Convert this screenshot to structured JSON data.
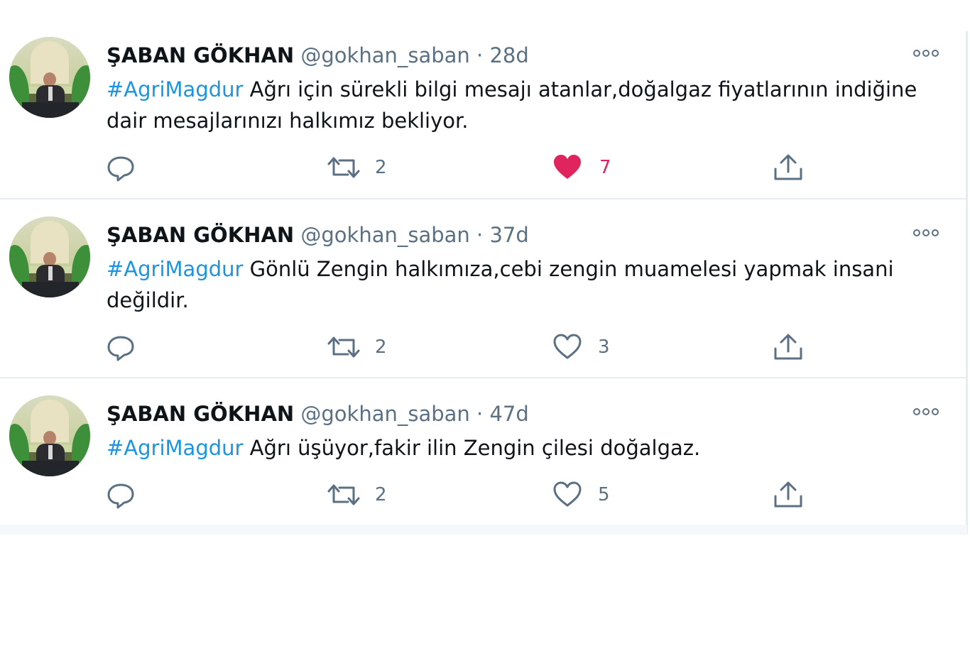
{
  "colors": {
    "hashtag": "#1b95e0",
    "secondary": "#5b7083",
    "like_active": "#e0245e",
    "divider": "#e6ecf0"
  },
  "tweets": [
    {
      "author_name": "ŞABAN GÖKHAN",
      "handle": "@gokhan_saban",
      "separator": "·",
      "time": "28d",
      "hashtag": "#AgriMagdur",
      "body": " Ağrı için sürekli bilgi mesajı atanlar,doğalgaz fiyatlarının indiğine dair mesajlarınızı halkımız bekliyor.",
      "actions": {
        "reply_count": "",
        "retweet_count": "2",
        "like_count": "7",
        "liked": true
      },
      "icons": [
        "reply-icon",
        "retweet-icon",
        "heart-filled-icon",
        "share-icon",
        "more-icon"
      ]
    },
    {
      "author_name": "ŞABAN GÖKHAN",
      "handle": "@gokhan_saban",
      "separator": "·",
      "time": "37d",
      "hashtag": "#AgriMagdur",
      "body": " Gönlü Zengin halkımıza,cebi zengin muamelesi yapmak insani değildir.",
      "actions": {
        "reply_count": "",
        "retweet_count": "2",
        "like_count": "3",
        "liked": false
      },
      "icons": [
        "reply-icon",
        "retweet-icon",
        "heart-icon",
        "share-icon",
        "more-icon"
      ]
    },
    {
      "author_name": "ŞABAN GÖKHAN",
      "handle": "@gokhan_saban",
      "separator": "·",
      "time": "47d",
      "hashtag": "#AgriMagdur",
      "body": " Ağrı üşüyor,fakir ilin Zengin çilesi doğalgaz.",
      "actions": {
        "reply_count": "",
        "retweet_count": "2",
        "like_count": "5",
        "liked": false
      },
      "icons": [
        "reply-icon",
        "retweet-icon",
        "heart-icon",
        "share-icon",
        "more-icon"
      ]
    }
  ]
}
